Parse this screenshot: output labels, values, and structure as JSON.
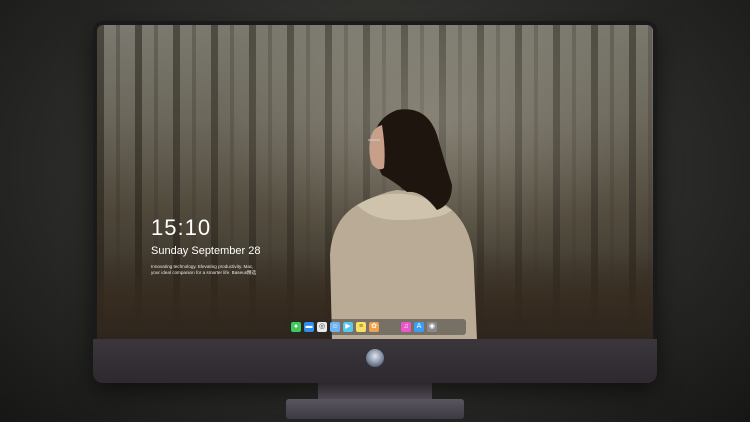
{
  "lockscreen": {
    "time": "15:10",
    "date": "Sunday September 28",
    "tagline": "Innovating technology. Elevating productivity. Mac, your ideal companion for a smarter life. Baseus精选"
  },
  "dock": {
    "apps": [
      {
        "icon": "messages-icon",
        "color": "#3ec95a"
      },
      {
        "icon": "files-icon",
        "color": "#2f8cf0"
      },
      {
        "icon": "safari-icon",
        "color": "#e9e9ea"
      },
      {
        "icon": "finder-icon",
        "color": "#6fb3f2"
      },
      {
        "icon": "video-icon",
        "color": "#58c6f4"
      },
      {
        "icon": "notes-icon",
        "color": "#f7e06a"
      },
      {
        "icon": "photos-icon",
        "color": "#f0a34a"
      },
      {
        "icon": "music-icon",
        "color": "#e957c9"
      },
      {
        "icon": "appstore-icon",
        "color": "#3c9df3"
      },
      {
        "icon": "camera-icon",
        "color": "#8a8a8e"
      }
    ]
  }
}
